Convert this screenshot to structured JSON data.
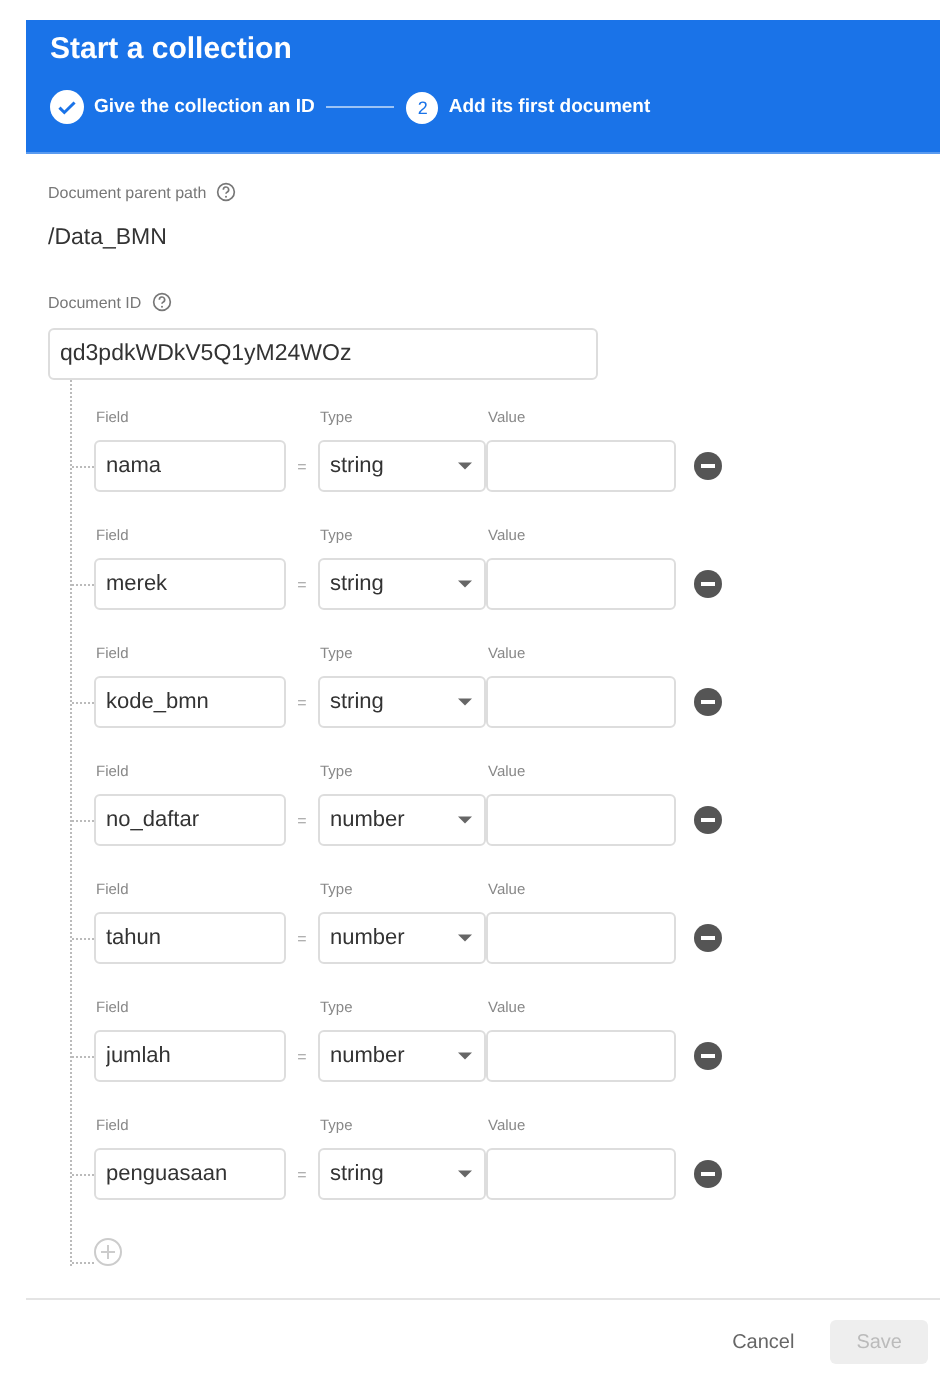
{
  "header": {
    "title": "Start a collection",
    "steps": [
      {
        "label": "Give the collection an ID",
        "completed": true
      },
      {
        "number": "2",
        "label": "Add its first document",
        "completed": false
      }
    ]
  },
  "parent_path": {
    "label": "Document parent path",
    "value": "/Data_BMN"
  },
  "document_id": {
    "label": "Document ID",
    "value": "qd3pdkWDkV5Q1yM24WOz"
  },
  "fields": [
    {
      "field_label": "Field",
      "type_label": "Type",
      "value_label": "Value",
      "name": "nama",
      "equals": "=",
      "type": "string"
    },
    {
      "field_label": "Field",
      "type_label": "Type",
      "value_label": "Value",
      "name": "merek",
      "equals": "=",
      "type": "string"
    },
    {
      "field_label": "Field",
      "type_label": "Type",
      "value_label": "Value",
      "name": "kode_bmn",
      "equals": "=",
      "type": "string"
    },
    {
      "field_label": "Field",
      "type_label": "Type",
      "value_label": "Value",
      "name": "no_daftar",
      "equals": "=",
      "type": "number"
    },
    {
      "field_label": "Field",
      "type_label": "Type",
      "value_label": "Value",
      "name": "tahun",
      "equals": "=",
      "type": "number"
    },
    {
      "field_label": "Field",
      "type_label": "Type",
      "value_label": "Value",
      "name": "jumlah",
      "equals": "=",
      "type": "number"
    },
    {
      "field_label": "Field",
      "type_label": "Type",
      "value_label": "Value",
      "name": "penguasaan",
      "equals": "=",
      "type": "string"
    }
  ],
  "buttons": [
    {
      "label": "Cancel",
      "kind": "text",
      "disabled": false
    },
    {
      "label": "Save",
      "kind": "raised",
      "disabled": true
    }
  ]
}
